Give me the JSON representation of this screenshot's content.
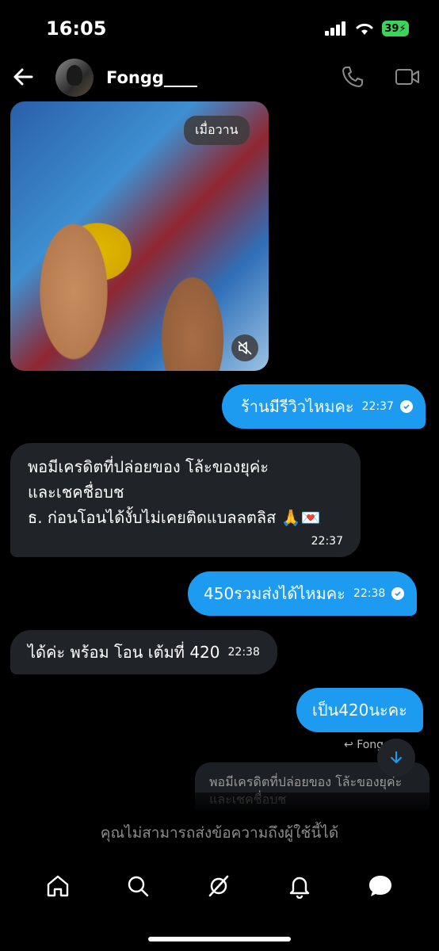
{
  "status_bar": {
    "time": "16:05",
    "battery": "39"
  },
  "header": {
    "contact_name": "Fongg____"
  },
  "media": {
    "badge": "เมื่อวาน"
  },
  "messages": [
    {
      "direction": "out",
      "text": "ร้านมีรีวิวไหมคะ",
      "time": "22:37"
    },
    {
      "direction": "in",
      "lines": [
        "พอมีเครดิตที่ปล่อยของ โล้ะของยุค่ะ",
        "และเชคชื่อบช",
        "ธ. ก่อนโอนได้งั้บไม่เคยติดแบลลตลิส 🙏💌"
      ],
      "time": "22:37"
    },
    {
      "direction": "out",
      "text": "450รวมส่งได้ไหมคะ",
      "time": "22:38"
    },
    {
      "direction": "in",
      "text": "ได้ค่ะ พร้อม โอน เต้มที่ 420",
      "time": "22:38"
    },
    {
      "direction": "out",
      "text": "เป็น420นะคะ"
    }
  ],
  "reply_preview": {
    "label": "Fongg",
    "quoted": "พอมีเครดิตที่ปล่อยของ โล้ะของยุค่ะ และเชคชื่อบช"
  },
  "notice": "คุณไม่สามารถส่งข้อความถึงผู้ใช้นี้ได้",
  "icons": {
    "back": "arrow-left-icon",
    "call": "phone-icon",
    "video": "video-camera-icon",
    "mute": "speaker-muted-icon",
    "scroll": "arrow-down-icon",
    "nav": [
      "home-icon",
      "search-icon",
      "grok-icon",
      "bell-icon",
      "messages-icon"
    ]
  },
  "colors": {
    "accent": "#1d9bf0",
    "incoming_bubble": "#202327",
    "battery": "#3cd35a"
  }
}
